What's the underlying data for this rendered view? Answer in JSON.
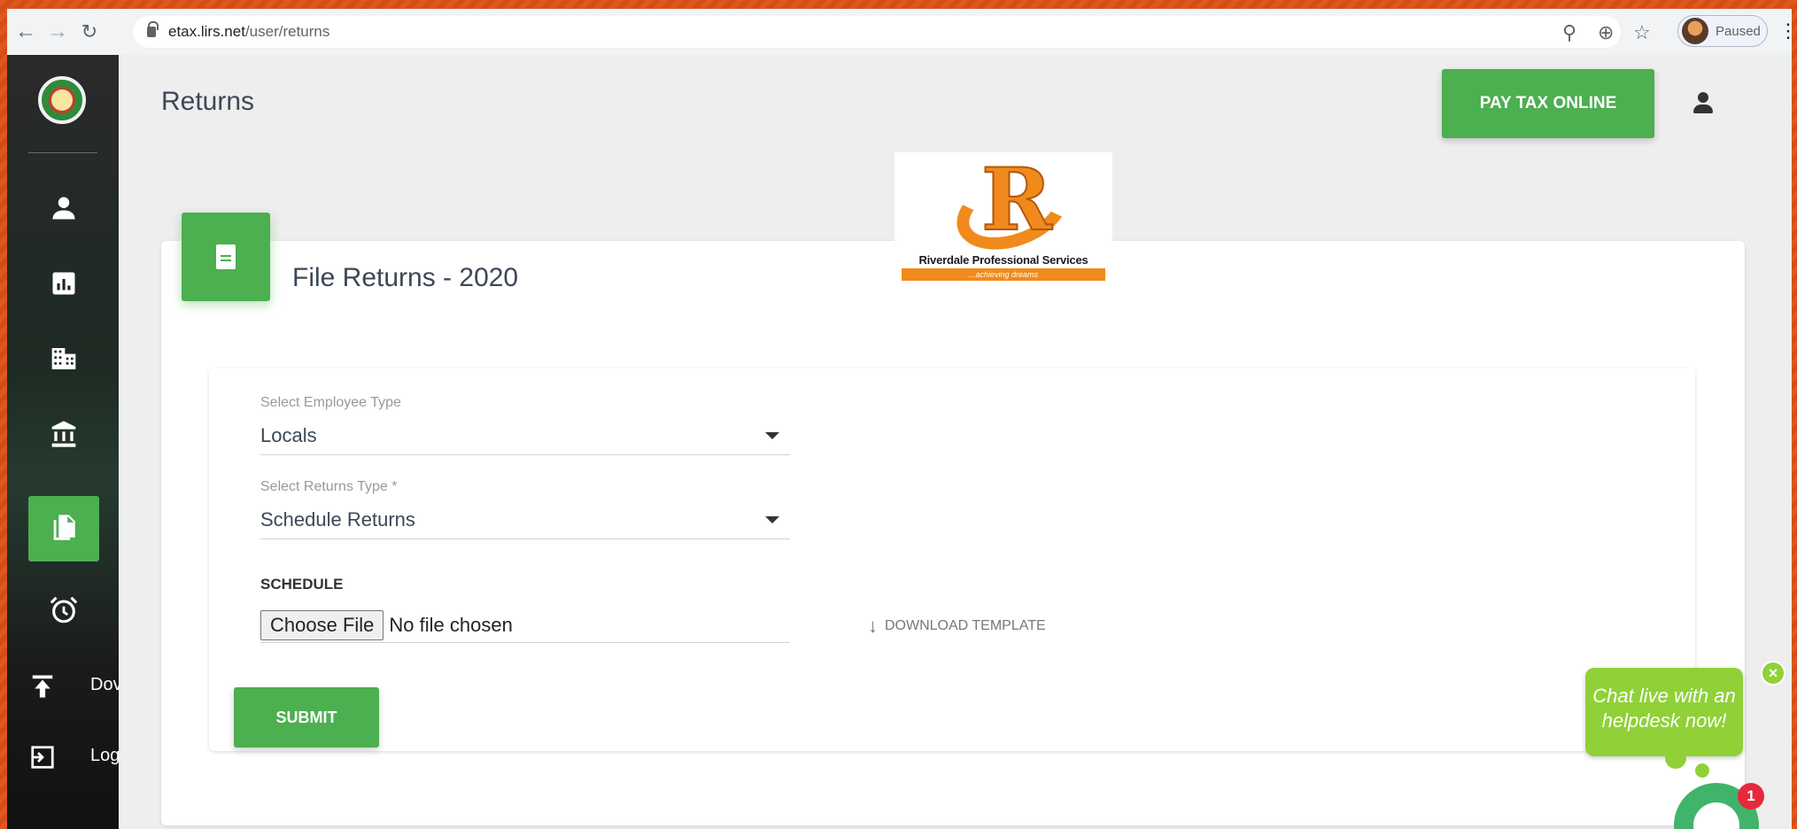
{
  "browser": {
    "url_host": "etax.lirs.net",
    "url_path": "/user/returns",
    "profile_status": "Paused",
    "nav_icons": [
      "back-icon",
      "forward-icon",
      "reload-icon"
    ],
    "toolbar_icons": [
      "key-icon",
      "zoom-icon",
      "star-icon",
      "more-icon"
    ]
  },
  "sidebar": {
    "items": [
      {
        "icon": "user-icon",
        "label": ""
      },
      {
        "icon": "chart-icon",
        "label": ""
      },
      {
        "icon": "building-icon",
        "label": ""
      },
      {
        "icon": "bank-icon",
        "label": ""
      },
      {
        "icon": "files-icon",
        "label": "",
        "active": true
      },
      {
        "icon": "alarm-icon",
        "label": ""
      },
      {
        "icon": "upload-icon",
        "label": "Dov"
      },
      {
        "icon": "logout-icon",
        "label": "Log"
      }
    ]
  },
  "header": {
    "title": "Returns",
    "pay_button": "PAY TAX ONLINE"
  },
  "card": {
    "title": "File Returns - 2020"
  },
  "logo": {
    "name": "Riverdale Professional Services",
    "tagline": "...achieving dreams"
  },
  "form": {
    "employee_type_label": "Select Employee Type",
    "employee_type_value": "Locals",
    "returns_type_label": "Select Returns Type *",
    "returns_type_value": "Schedule Returns",
    "schedule_label": "SCHEDULE",
    "choose_file_label": "Choose File",
    "no_file_text": "No file chosen",
    "download_template": "DOWNLOAD TEMPLATE",
    "submit_label": "SUBMIT"
  },
  "chat": {
    "message": "Chat live with an helpdesk now!",
    "badge_count": "1"
  },
  "colors": {
    "accent_green": "#4caf50",
    "chat_green": "#8fd137",
    "frame_orange": "#d9531e",
    "badge_red": "#e5293a"
  }
}
